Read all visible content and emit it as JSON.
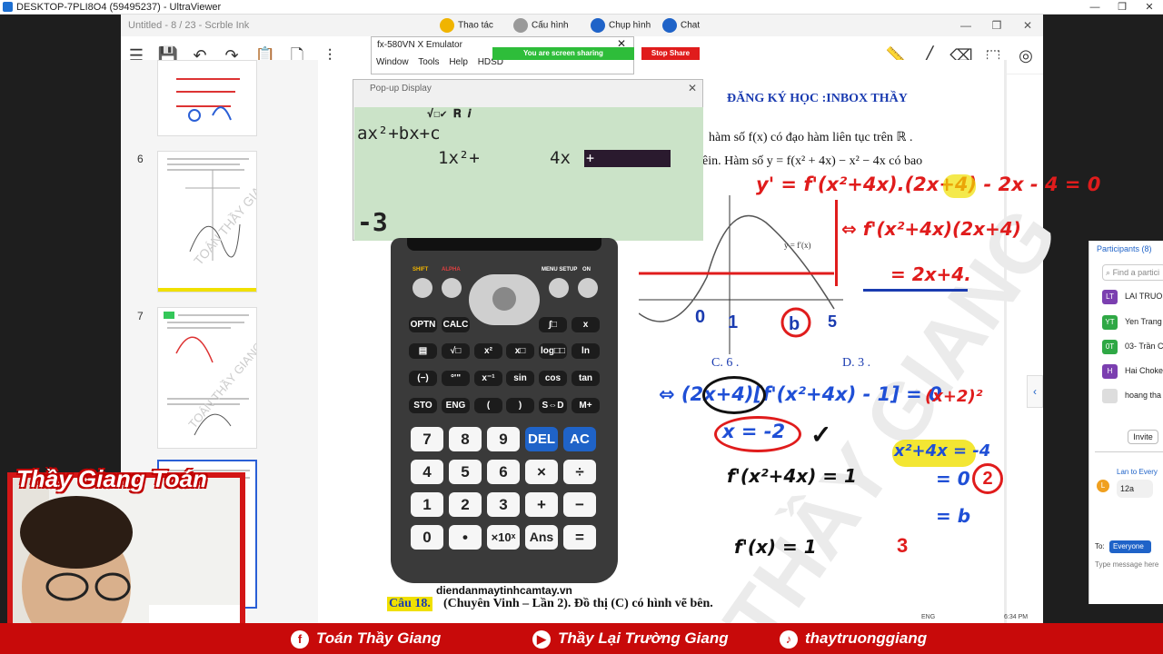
{
  "uv": {
    "title": "DESKTOP-7PLI8O4 (59495237) - UltraViewer",
    "controls": [
      "—",
      "❒",
      "✕"
    ]
  },
  "app": {
    "title": "Untitled - 8 / 23 - Scrble Ink",
    "win_controls": [
      "—",
      "❒",
      "✕"
    ]
  },
  "meeting": {
    "items": [
      {
        "label": "Thao tác",
        "icon": "hand-icon",
        "color": "#f0b400"
      },
      {
        "label": "Cấu hình",
        "icon": "gear-icon",
        "color": "#888888"
      },
      {
        "label": "Chụp hình",
        "icon": "camera-icon",
        "color": "#1f63c8"
      },
      {
        "label": "Chat",
        "icon": "chat-icon",
        "color": "#1f63c8"
      }
    ],
    "sharing_label": "You are screen sharing",
    "stop_label": "Stop Share"
  },
  "emulator": {
    "title": "fx-580VN X Emulator",
    "menu": [
      "Window",
      "Tools",
      "Help",
      "HDSD"
    ],
    "popup_title": "Pop-up Display",
    "lcd": {
      "indicators": "√☐✔   𝐑         𝒊",
      "line1": "ax²+bx+c",
      "coef_a": "1x²+",
      "coef_b": "4x",
      "cursor": "+",
      "result": "-3"
    },
    "url": "diendanmaytinhcamtay.vn"
  },
  "calculator": {
    "top_labels": [
      "SHIFT",
      "ALPHA",
      "MENU SETUP",
      "ON"
    ],
    "rows": [
      [
        "OPTN",
        "CALC",
        "∫□",
        "x"
      ],
      [
        "▤",
        "√□",
        "x²",
        "x□",
        "log□□",
        "ln"
      ],
      [
        "(−)",
        "°'\"",
        "x⁻¹",
        "sin",
        "cos",
        "tan"
      ],
      [
        "STO",
        "ENG",
        "(",
        ")",
        "S⇔D",
        "M+"
      ]
    ],
    "digits": [
      [
        "7",
        "8",
        "9",
        "DEL",
        "AC"
      ],
      [
        "4",
        "5",
        "6",
        "×",
        "÷"
      ],
      [
        "1",
        "2",
        "3",
        "+",
        "−"
      ],
      [
        "0",
        "•",
        "×10ˣ",
        "Ans",
        "="
      ]
    ]
  },
  "document": {
    "heading": "ĐĂNG KÝ HỌC :INBOX THẦY",
    "line1": "hàm số  f(x)  có đạo hàm liên tục trên  ℝ .",
    "line2": "êin.  Hàm số   y = f(x² + 4x) − x² − 4x   có  bao",
    "option_c": "C.  6 .",
    "option_d": "D.  3 .",
    "question": "Câu 18.",
    "question_text": "(Chuyên Vinh – Lần 2). Đồ thị (C) có hình vẽ bên.",
    "graph_label": "y = f′(x)"
  },
  "handwriting": {
    "eq1": "y' = f'(x²+4x).(2x+4) - 2x - 4 = 0",
    "eq2": "⇔ f'(x²+4x)(2x+4)",
    "eq3": "= 2x+4.",
    "eq4": "⇔ (2x+4)[f'(x²+4x) - 1] = 0",
    "eq5": "x = -2",
    "eq6": "f'(x²+4x) = 1",
    "eq7": "f'(x) = 1",
    "eq8": "x²+4x = -4",
    "eq9": "(x+2)²",
    "eq10": "= 0",
    "eq11": "= b",
    "circle2": "2",
    "count": "3",
    "graph_marks": [
      "0",
      "1",
      "b",
      "5"
    ]
  },
  "sidebar": {
    "pages": [
      "6",
      "7"
    ]
  },
  "webcam": {
    "title": "Thầy Giang Toán"
  },
  "banner": [
    {
      "label": "Toán Thầy Giang",
      "icon": "facebook-icon",
      "glyph": "f"
    },
    {
      "label": "Thầy Lại Trường Giang",
      "icon": "youtube-icon",
      "glyph": "▶"
    },
    {
      "label": "thaytruonggiang",
      "icon": "tiktok-icon",
      "glyph": "♪"
    }
  ],
  "participants": {
    "title": "Participants (8)",
    "search_placeholder": "Find a partici",
    "people": [
      {
        "initials": "LT",
        "name": "LAI TRUON",
        "color": "#7b3fb0"
      },
      {
        "initials": "YT",
        "name": "Yen Trang",
        "color": "#2fa845"
      },
      {
        "initials": "0T",
        "name": "03- Trần C",
        "color": "#2fa845"
      },
      {
        "initials": "H",
        "name": "Hai Choke",
        "color": "#7b3fb0"
      },
      {
        "initials": "",
        "name": "hoang tha",
        "color": "#cccccc"
      }
    ],
    "invite_label": "Invite",
    "chat_from": "Lan to Every",
    "chat_msg": "12a",
    "chat_initial": "L",
    "to_label": "To:",
    "to_value": "Everyone",
    "message_placeholder": "Type message here"
  },
  "taskbar": {
    "lang": "ENG",
    "time": "6:34 PM"
  }
}
